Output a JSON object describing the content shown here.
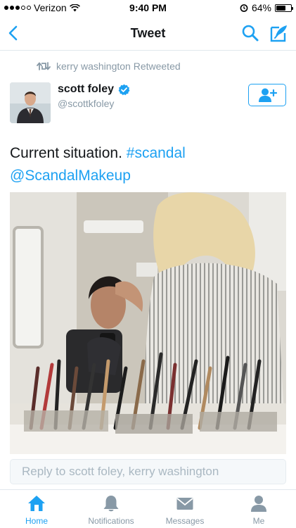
{
  "status_bar": {
    "carrier": "Verizon",
    "time": "9:40 PM",
    "battery": "64%",
    "battery_level": 0.64
  },
  "nav": {
    "title": "Tweet",
    "back_icon": "chevron-left-icon",
    "search_icon": "search-icon",
    "compose_icon": "compose-icon"
  },
  "retweet": {
    "label": "kerry washington Retweeted"
  },
  "author": {
    "name": "scott foley",
    "handle": "@scottkfoley",
    "verified": true
  },
  "tweet": {
    "text_plain": "Current situation.",
    "hashtag": "#scandal",
    "mention": "@ScandalMakeup"
  },
  "reply": {
    "placeholder": "Reply to scott foley, kerry washington"
  },
  "tabs": [
    {
      "label": "Home",
      "icon": "home-icon",
      "active": true
    },
    {
      "label": "Notifications",
      "icon": "bell-icon",
      "active": false
    },
    {
      "label": "Messages",
      "icon": "envelope-icon",
      "active": false
    },
    {
      "label": "Me",
      "icon": "person-icon",
      "active": false
    }
  ],
  "colors": {
    "accent": "#1da1f2",
    "muted": "#8899a6",
    "text": "#14171a"
  }
}
